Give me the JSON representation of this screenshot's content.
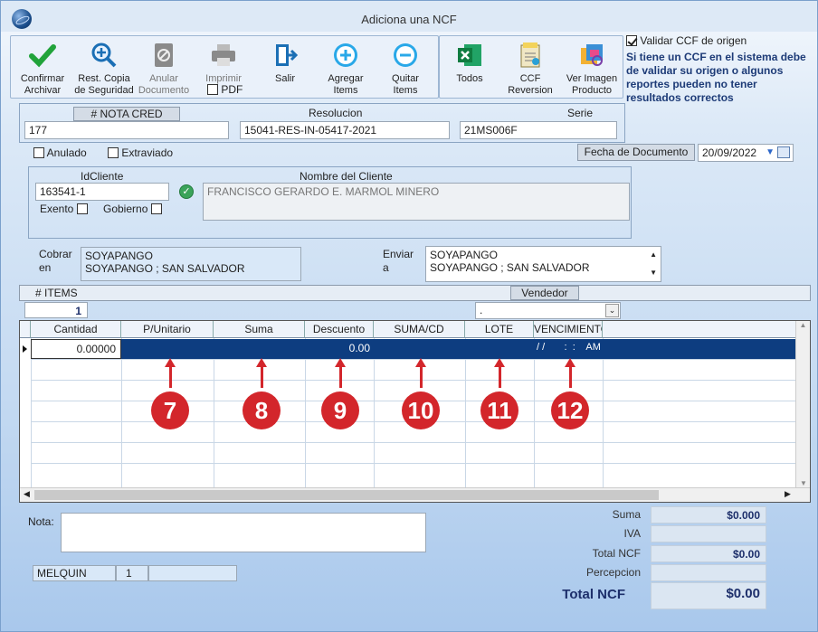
{
  "window": {
    "title": "Adiciona una NCF"
  },
  "toolbar": {
    "confirm": "Confirmar Archivar",
    "backup": "Rest. Copia de Seguridad",
    "void": "Anular Documento",
    "print": "Imprimir",
    "pdf": "PDF",
    "exit": "Salir",
    "add_items": "Agregar Items",
    "remove_items": "Quitar Items",
    "all": "Todos",
    "ccf_rev": "CCF Reversion",
    "view_img": "Ver Imagen Producto"
  },
  "validate": {
    "label": "Validar CCF de origen",
    "checked": true,
    "note": "Si tiene un CCF en el sistema debe de validar su origen o algunos reportes pueden no tener resultados correctos"
  },
  "header": {
    "nota_label": "# NOTA CRED",
    "nota_value": "177",
    "resolucion_label": "Resolucion",
    "resolucion_value": "15041-RES-IN-05417-2021",
    "serie_label": "Serie",
    "serie_value": "21MS006F"
  },
  "flags": {
    "anulado": "Anulado",
    "extraviado": "Extraviado"
  },
  "fecha": {
    "label": "Fecha de  Documento",
    "value": "20/09/2022"
  },
  "cliente": {
    "id_label": "IdCliente",
    "id_value": "163541-1",
    "nombre_label": "Nombre del Cliente",
    "nombre_value": "FRANCISCO GERARDO E. MARMOL MINERO",
    "exento": "Exento",
    "gobierno": "Gobierno"
  },
  "cobrar": {
    "label1": "Cobrar",
    "label2": "en",
    "line1": "SOYAPANGO",
    "line2": "SOYAPANGO ; SAN SALVADOR"
  },
  "enviar": {
    "label1": "Enviar",
    "label2": "a",
    "line1": "SOYAPANGO",
    "line2": "SOYAPANGO ; SAN SALVADOR"
  },
  "items": {
    "label": "# ITEMS",
    "count": "1",
    "vendedor_label": "Vendedor",
    "vendedor_value": "."
  },
  "grid": {
    "columns": [
      "Cantidad",
      "P/Unitario",
      "Suma",
      "Descuento",
      "SUMA/CD",
      "LOTE",
      "VENCIMIENTO"
    ],
    "row": {
      "cantidad": "0.00000",
      "descuento": "0.00",
      "venc": "/ /       :  :    AM"
    }
  },
  "markers": [
    "7",
    "8",
    "9",
    "10",
    "11",
    "12"
  ],
  "nota": {
    "label": "Nota:"
  },
  "footer": {
    "user": "MELQUIN",
    "num": "1"
  },
  "totals": {
    "suma_label": "Suma",
    "suma_value": "$0.000",
    "iva_label": "IVA",
    "total_ncf_label": "Total NCF",
    "total_ncf_value": "$0.00",
    "percepcion_label": "Percepcion",
    "grand_label": "Total NCF",
    "grand_value": "$0.00"
  },
  "colors": {
    "accent": "#0d3d80",
    "marker": "#d3262b"
  }
}
